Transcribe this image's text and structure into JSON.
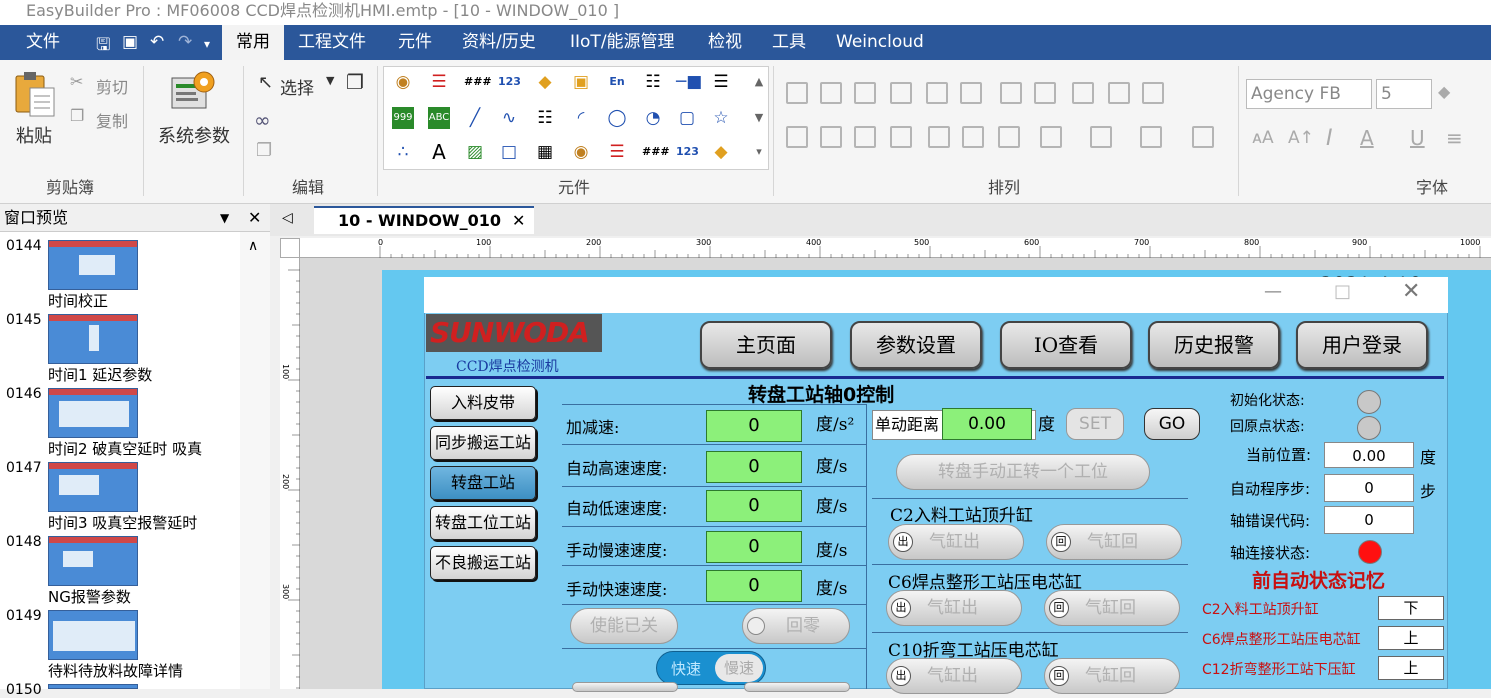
{
  "window": {
    "title": "EasyBuilder Pro : MF06008 CCD焊点检测机HMI.emtp - [10 - WINDOW_010 ]"
  },
  "menu": {
    "file": "文件",
    "tabs": [
      "常用",
      "工程文件",
      "元件",
      "资料/历史",
      "IIoT/能源管理",
      "检视",
      "工具",
      "Weincloud"
    ]
  },
  "ribbon": {
    "paste": "粘贴",
    "cut": "剪切",
    "copy": "复制",
    "clipboard": "剪贴簿",
    "system_params": "系统参数",
    "select": "选择",
    "edit": "编辑",
    "elements": "元件",
    "arrange": "排列",
    "font": "字体",
    "font_name": "Agency FB",
    "font_size": "5"
  },
  "preview": {
    "title": "窗口预览",
    "items": [
      {
        "num": "0144",
        "label": "时间校正"
      },
      {
        "num": "0145",
        "label": "时间1 延迟参数"
      },
      {
        "num": "0146",
        "label": "时间2 破真空延时  吸真"
      },
      {
        "num": "0147",
        "label": "时间3 吸真空报警延时"
      },
      {
        "num": "0148",
        "label": "NG报警参数"
      },
      {
        "num": "0149",
        "label": "待料待放料故障详情"
      },
      {
        "num": "0150",
        "label": ""
      }
    ]
  },
  "doc_tab": "10 - WINDOW_010",
  "ruler_ticks": [
    "0",
    "100",
    "200",
    "300",
    "400",
    "500",
    "600",
    "700",
    "800",
    "900",
    "1000"
  ],
  "ruler_v_ticks": [
    "100",
    "200",
    "300"
  ],
  "hmi": {
    "date_partial": "2021 4 10",
    "logo": "SUNWODA",
    "subtitle": "CCD焊点检测机",
    "nav": [
      "主页面",
      "参数设置",
      "IO查看",
      "历史报警",
      "用户登录"
    ],
    "title": "转盘工站轴0控制",
    "side": [
      "入料皮带",
      "同步搬运工站",
      "转盘工站",
      "转盘工位工站",
      "不良搬运工站"
    ],
    "params": [
      {
        "label": "加减速:",
        "value": "0",
        "unit": "度/s²"
      },
      {
        "label": "自动高速速度:",
        "value": "0",
        "unit": "度/s"
      },
      {
        "label": "自动低速速度:",
        "value": "0",
        "unit": "度/s"
      },
      {
        "label": "手动慢速速度:",
        "value": "0",
        "unit": "度/s"
      },
      {
        "label": "手动快速速度:",
        "value": "0",
        "unit": "度/s"
      }
    ],
    "enable_btn": "使能已关",
    "home_btn": "回零",
    "toggle_fast": "快速",
    "toggle_slow": "慢速",
    "jog_label": "单动距离",
    "jog_value": "0.00",
    "jog_unit": "度",
    "set_btn": "SET",
    "go_btn": "GO",
    "rotate_btn": "转盘手动正转一个工位",
    "cyl": [
      {
        "title": "C2入料工站顶升缸",
        "out": "气缸出",
        "back": "气缸回",
        "out_tag": "出",
        "back_tag": "回"
      },
      {
        "title": "C6焊点整形工站压电芯缸",
        "out": "气缸出",
        "back": "气缸回",
        "out_tag": "出",
        "back_tag": "回"
      },
      {
        "title": "C10折弯工站压电芯缸",
        "out": "气缸出",
        "back": "气缸回",
        "out_tag": "出",
        "back_tag": "回"
      }
    ],
    "status": {
      "init": "初始化状态:",
      "origin": "回原点状态:",
      "pos_label": "当前位置:",
      "pos_value": "0.00",
      "pos_unit": "度",
      "step_label": "自动程序步:",
      "step_value": "0",
      "step_unit": "步",
      "err_label": "轴错误代码:",
      "err_value": "0",
      "conn_label": "轴连接状态:",
      "conn_color": "#ff1010"
    },
    "memory": {
      "title": "前自动状态记忆",
      "rows": [
        {
          "label": "C2入料工站顶升缸",
          "value": "下"
        },
        {
          "label": "C6焊点整形工站压电芯缸",
          "value": "上"
        },
        {
          "label": "C12折弯整形工站下压缸",
          "value": "上"
        }
      ]
    }
  }
}
